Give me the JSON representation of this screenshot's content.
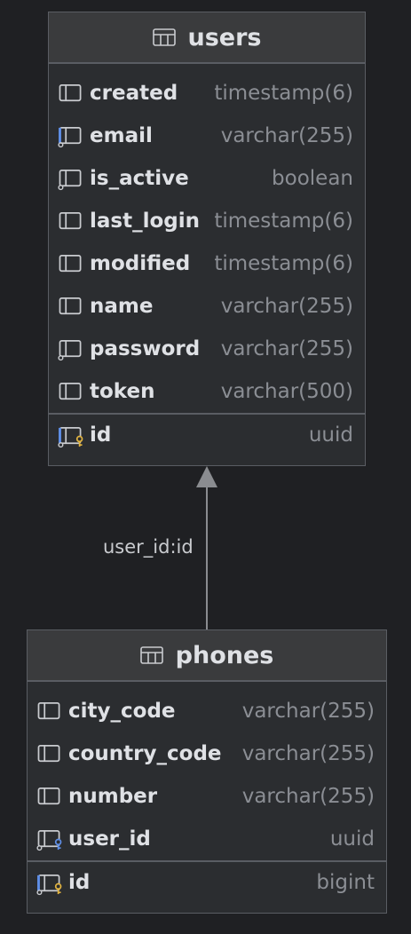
{
  "users": {
    "title": "users",
    "columns": [
      {
        "name": "created",
        "type": "timestamp(6)",
        "icon": "column-icon"
      },
      {
        "name": "email",
        "type": "varchar(255)",
        "icon": "unique-column-icon"
      },
      {
        "name": "is_active",
        "type": "boolean",
        "icon": "nullable-column-icon"
      },
      {
        "name": "last_login",
        "type": "timestamp(6)",
        "icon": "column-icon"
      },
      {
        "name": "modified",
        "type": "timestamp(6)",
        "icon": "column-icon"
      },
      {
        "name": "name",
        "type": "varchar(255)",
        "icon": "column-icon"
      },
      {
        "name": "password",
        "type": "varchar(255)",
        "icon": "nullable-column-icon"
      },
      {
        "name": "token",
        "type": "varchar(500)",
        "icon": "column-icon"
      }
    ],
    "primary_key": {
      "name": "id",
      "type": "uuid",
      "icon": "primary-key-icon"
    }
  },
  "phones": {
    "title": "phones",
    "columns": [
      {
        "name": "city_code",
        "type": "varchar(255)",
        "icon": "column-icon"
      },
      {
        "name": "country_code",
        "type": "varchar(255)",
        "icon": "column-icon"
      },
      {
        "name": "number",
        "type": "varchar(255)",
        "icon": "column-icon"
      },
      {
        "name": "user_id",
        "type": "uuid",
        "icon": "foreign-key-icon"
      }
    ],
    "primary_key": {
      "name": "id",
      "type": "bigint",
      "icon": "primary-key-icon"
    }
  },
  "relationship": {
    "label": "user_id:id"
  },
  "colors": {
    "background": "#1f2023",
    "panel": "#2b2d30",
    "header": "#3a3b3d",
    "key_gold": "#e2b441",
    "key_blue": "#5f8fe8"
  }
}
